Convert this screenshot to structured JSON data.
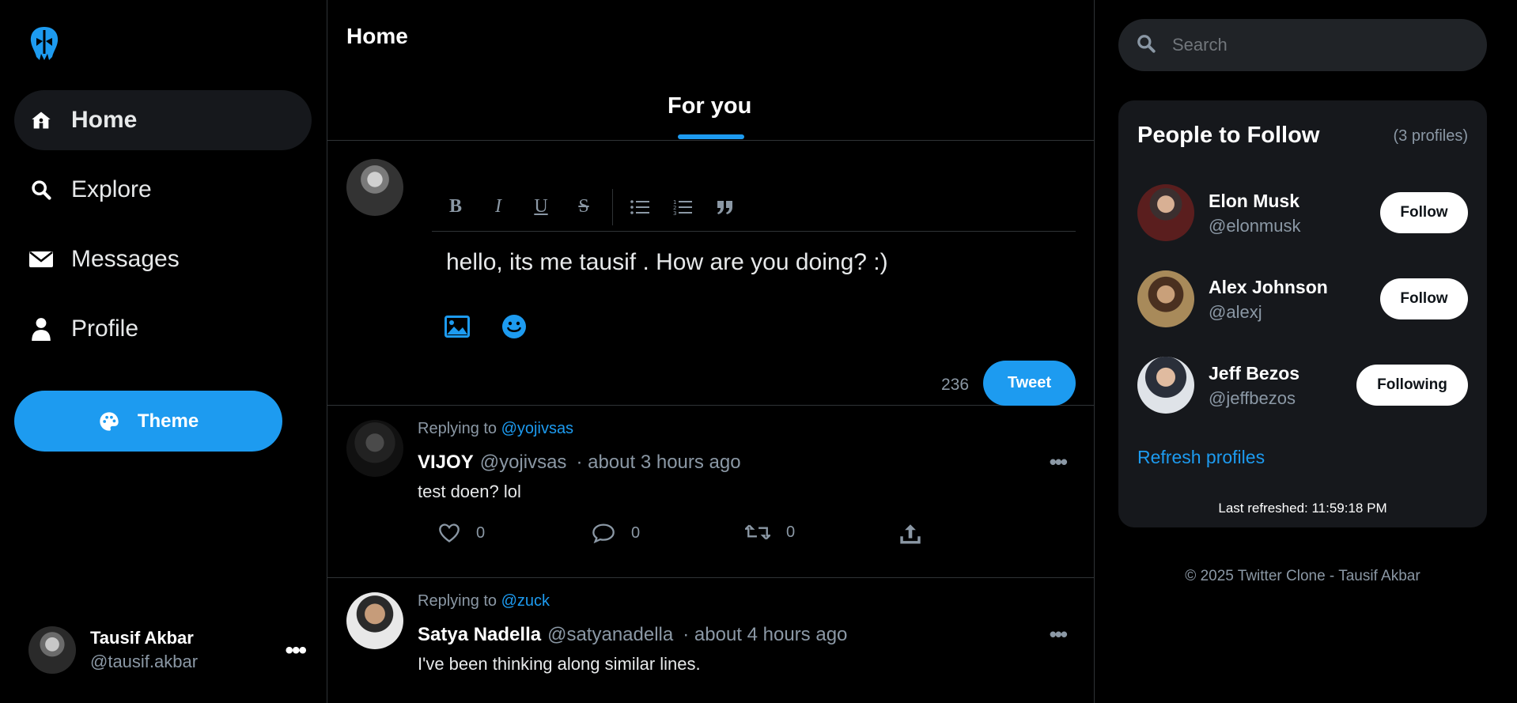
{
  "sidebar": {
    "logo": "bird-logo",
    "nav": [
      {
        "label": "Home",
        "icon": "home-icon",
        "active": true
      },
      {
        "label": "Explore",
        "icon": "search-icon"
      },
      {
        "label": "Messages",
        "icon": "envelope-icon"
      },
      {
        "label": "Profile",
        "icon": "user-icon"
      }
    ],
    "theme_label": "Theme",
    "user": {
      "name": "Tausif Akbar",
      "handle": "@tausif.akbar"
    }
  },
  "feed": {
    "title": "Home",
    "tab": "For you",
    "composer": {
      "text": "hello, its me tausif . How are you doing? :)",
      "char_count": "236",
      "tweet_label": "Tweet"
    },
    "posts": [
      {
        "replying_prefix": "Replying to",
        "replying_to": "@yojivsas",
        "name": "VIJOY",
        "handle": "@yojivsas",
        "time": "· about 3 hours ago",
        "body": "test doen? lol",
        "likes": "0",
        "comments": "0",
        "retweets": "0"
      },
      {
        "replying_prefix": "Replying to",
        "replying_to": "@zuck",
        "name": "Satya Nadella",
        "handle": "@satyanadella",
        "time": "· about 4 hours ago",
        "body": "I've been thinking along similar lines."
      }
    ]
  },
  "right": {
    "search_placeholder": "Search",
    "people": {
      "title": "People to Follow",
      "count": "(3 profiles)",
      "list": [
        {
          "name": "Elon Musk",
          "handle": "@elonmusk",
          "button": "Follow"
        },
        {
          "name": "Alex Johnson",
          "handle": "@alexj",
          "button": "Follow"
        },
        {
          "name": "Jeff Bezos",
          "handle": "@jeffbezos",
          "button": "Following"
        }
      ],
      "refresh": "Refresh profiles",
      "last_refreshed": "Last refreshed: 11:59:18 PM"
    },
    "footer": "© 2025 Twitter Clone - Tausif Akbar"
  },
  "colors": {
    "accent": "#1d9bf0",
    "bg": "#000000",
    "panel": "#16181c",
    "muted": "#8b98a5"
  }
}
